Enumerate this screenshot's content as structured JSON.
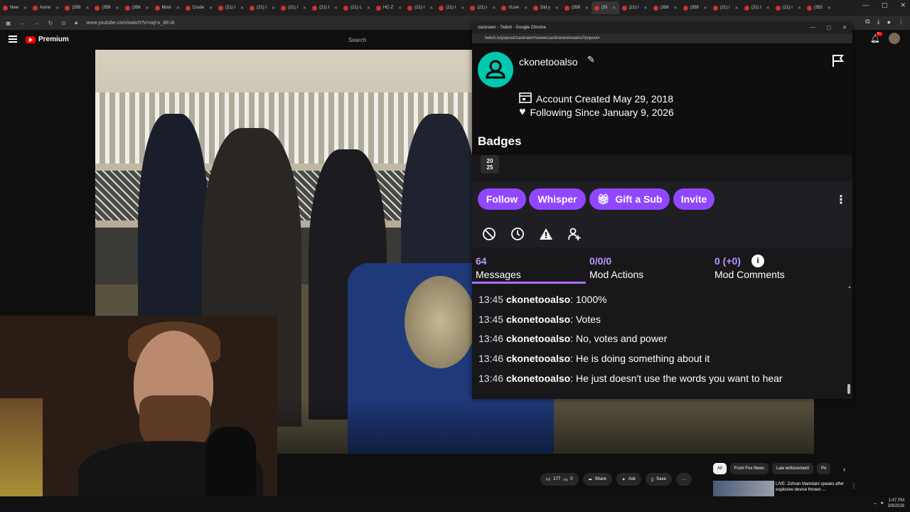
{
  "browser": {
    "tabs": [
      {
        "label": "New",
        "active": false
      },
      {
        "label": "Asmo",
        "active": false
      },
      {
        "label": "(358",
        "active": false
      },
      {
        "label": "(358",
        "active": false
      },
      {
        "label": "(356",
        "active": false
      },
      {
        "label": "Most",
        "active": false
      },
      {
        "label": "Crude",
        "active": false
      },
      {
        "label": "(21) I",
        "active": false
      },
      {
        "label": "(21) I",
        "active": false
      },
      {
        "label": "(21) I",
        "active": false
      },
      {
        "label": "(21) I",
        "active": false
      },
      {
        "label": "(21) L",
        "active": false
      },
      {
        "label": "HC-Z",
        "active": false
      },
      {
        "label": "(21) I",
        "active": false
      },
      {
        "label": "(21) I",
        "active": false
      },
      {
        "label": "(21) I",
        "active": false
      },
      {
        "label": "r/Live",
        "active": false
      },
      {
        "label": "Did y",
        "active": false
      },
      {
        "label": "(358",
        "active": false
      },
      {
        "label": "(35",
        "active": true
      },
      {
        "label": "(21) I",
        "active": false
      },
      {
        "label": "(358",
        "active": false
      },
      {
        "label": "(358",
        "active": false
      },
      {
        "label": "(21) I",
        "active": false
      },
      {
        "label": "(21) I",
        "active": false
      },
      {
        "label": "(21) I",
        "active": false
      },
      {
        "label": "(355",
        "active": false
      }
    ],
    "url": "www.youtube.com/watch?v=oql-o_88-iA"
  },
  "youtube": {
    "logo": "Premium",
    "search_placeholder": "Search",
    "notif_count": "9+",
    "likes": "177",
    "dislikes": "0",
    "share": "Share",
    "ask": "Ask",
    "save": "Save",
    "more": "⋯",
    "chips": [
      "All",
      "From Fox News",
      "Law enforcement",
      "Po"
    ],
    "rec_title": "LIVE: Zohran Mamdani speaks after explosive device thrown ..."
  },
  "taskbar": {
    "time": "1:47 PM",
    "date": "3/9/2026"
  },
  "twitch": {
    "window_title": "zackrawrr - Twitch - Google Chrome",
    "url": "twitch.tv/popout/zackrawrr/viewercard/ckonetooalso?popout=",
    "username": "ckonetooalso",
    "account_created": "Account Created May 29, 2018",
    "following_since": "Following Since January 9, 2026",
    "badges_title": "Badges",
    "badge_text": "20\n25",
    "buttons": {
      "follow": "Follow",
      "whisper": "Whisper",
      "gift": "Gift a Sub",
      "invite": "Invite"
    },
    "stats": {
      "messages_count": "64",
      "messages_label": "Messages",
      "mod_actions_count": "0/0/0",
      "mod_actions_label": "Mod Actions",
      "mod_comments_count": "0 (+0)",
      "mod_comments_label": "Mod Comments"
    },
    "messages": [
      {
        "time": "13:45",
        "user": "ckonetooalso",
        "text": ": 1000%"
      },
      {
        "time": "13:45",
        "user": "ckonetooalso",
        "text": ": Votes"
      },
      {
        "time": "13:46",
        "user": "ckonetooalso",
        "text": ": No, votes and power"
      },
      {
        "time": "13:46",
        "user": "ckonetooalso",
        "text": ": He is doing something about it"
      },
      {
        "time": "13:46",
        "user": "ckonetooalso",
        "text": ": He just doesn't use the words you want to hear"
      }
    ],
    "colors": {
      "accent": "#9147ff",
      "avatar": "#00c8af",
      "tab_underline": "#a970ff"
    }
  }
}
